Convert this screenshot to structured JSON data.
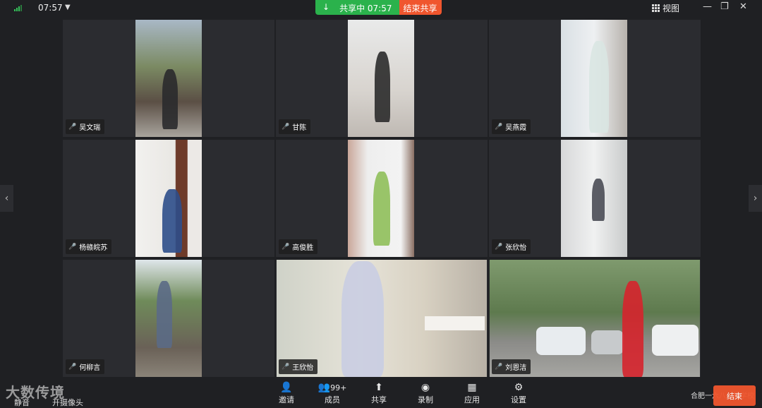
{
  "topbar": {
    "time": "07:57",
    "share_status": "共享中",
    "share_time": "07:57",
    "end_share": "结束共享",
    "view": "视图",
    "minimize": "—",
    "restore": "❐",
    "close": "✕"
  },
  "tiles": [
    {
      "name": "吴文瑞"
    },
    {
      "name": "甘陈"
    },
    {
      "name": "吴燕霞"
    },
    {
      "name": "杨赣皖苏"
    },
    {
      "name": "高俊胜"
    },
    {
      "name": "张欣怡"
    },
    {
      "name": "何柳言"
    },
    {
      "name": "王欣怡"
    },
    {
      "name": "刘恩洁"
    }
  ],
  "nav": {
    "prev": "‹",
    "next": "›"
  },
  "toolbar": {
    "mute": "静音",
    "camera": "开摄像头",
    "invite": "邀请",
    "members": "成员",
    "members_count": "99+",
    "share": "共享",
    "record": "录制",
    "apps": "应用",
    "settings": "设置",
    "end": "结束"
  },
  "watermark": "大数传境",
  "school_label": "合肥一六八…园学校",
  "colors": {
    "share_green": "#2bb24c",
    "end_orange": "#f0562e",
    "signal_green": "#35c25a"
  },
  "icons": {
    "download": "↓",
    "caret": "▼",
    "mic": "🎤",
    "invite": "👤",
    "members": "👥",
    "share": "⬆",
    "record": "◉",
    "apps": "▦",
    "settings": "⚙"
  }
}
